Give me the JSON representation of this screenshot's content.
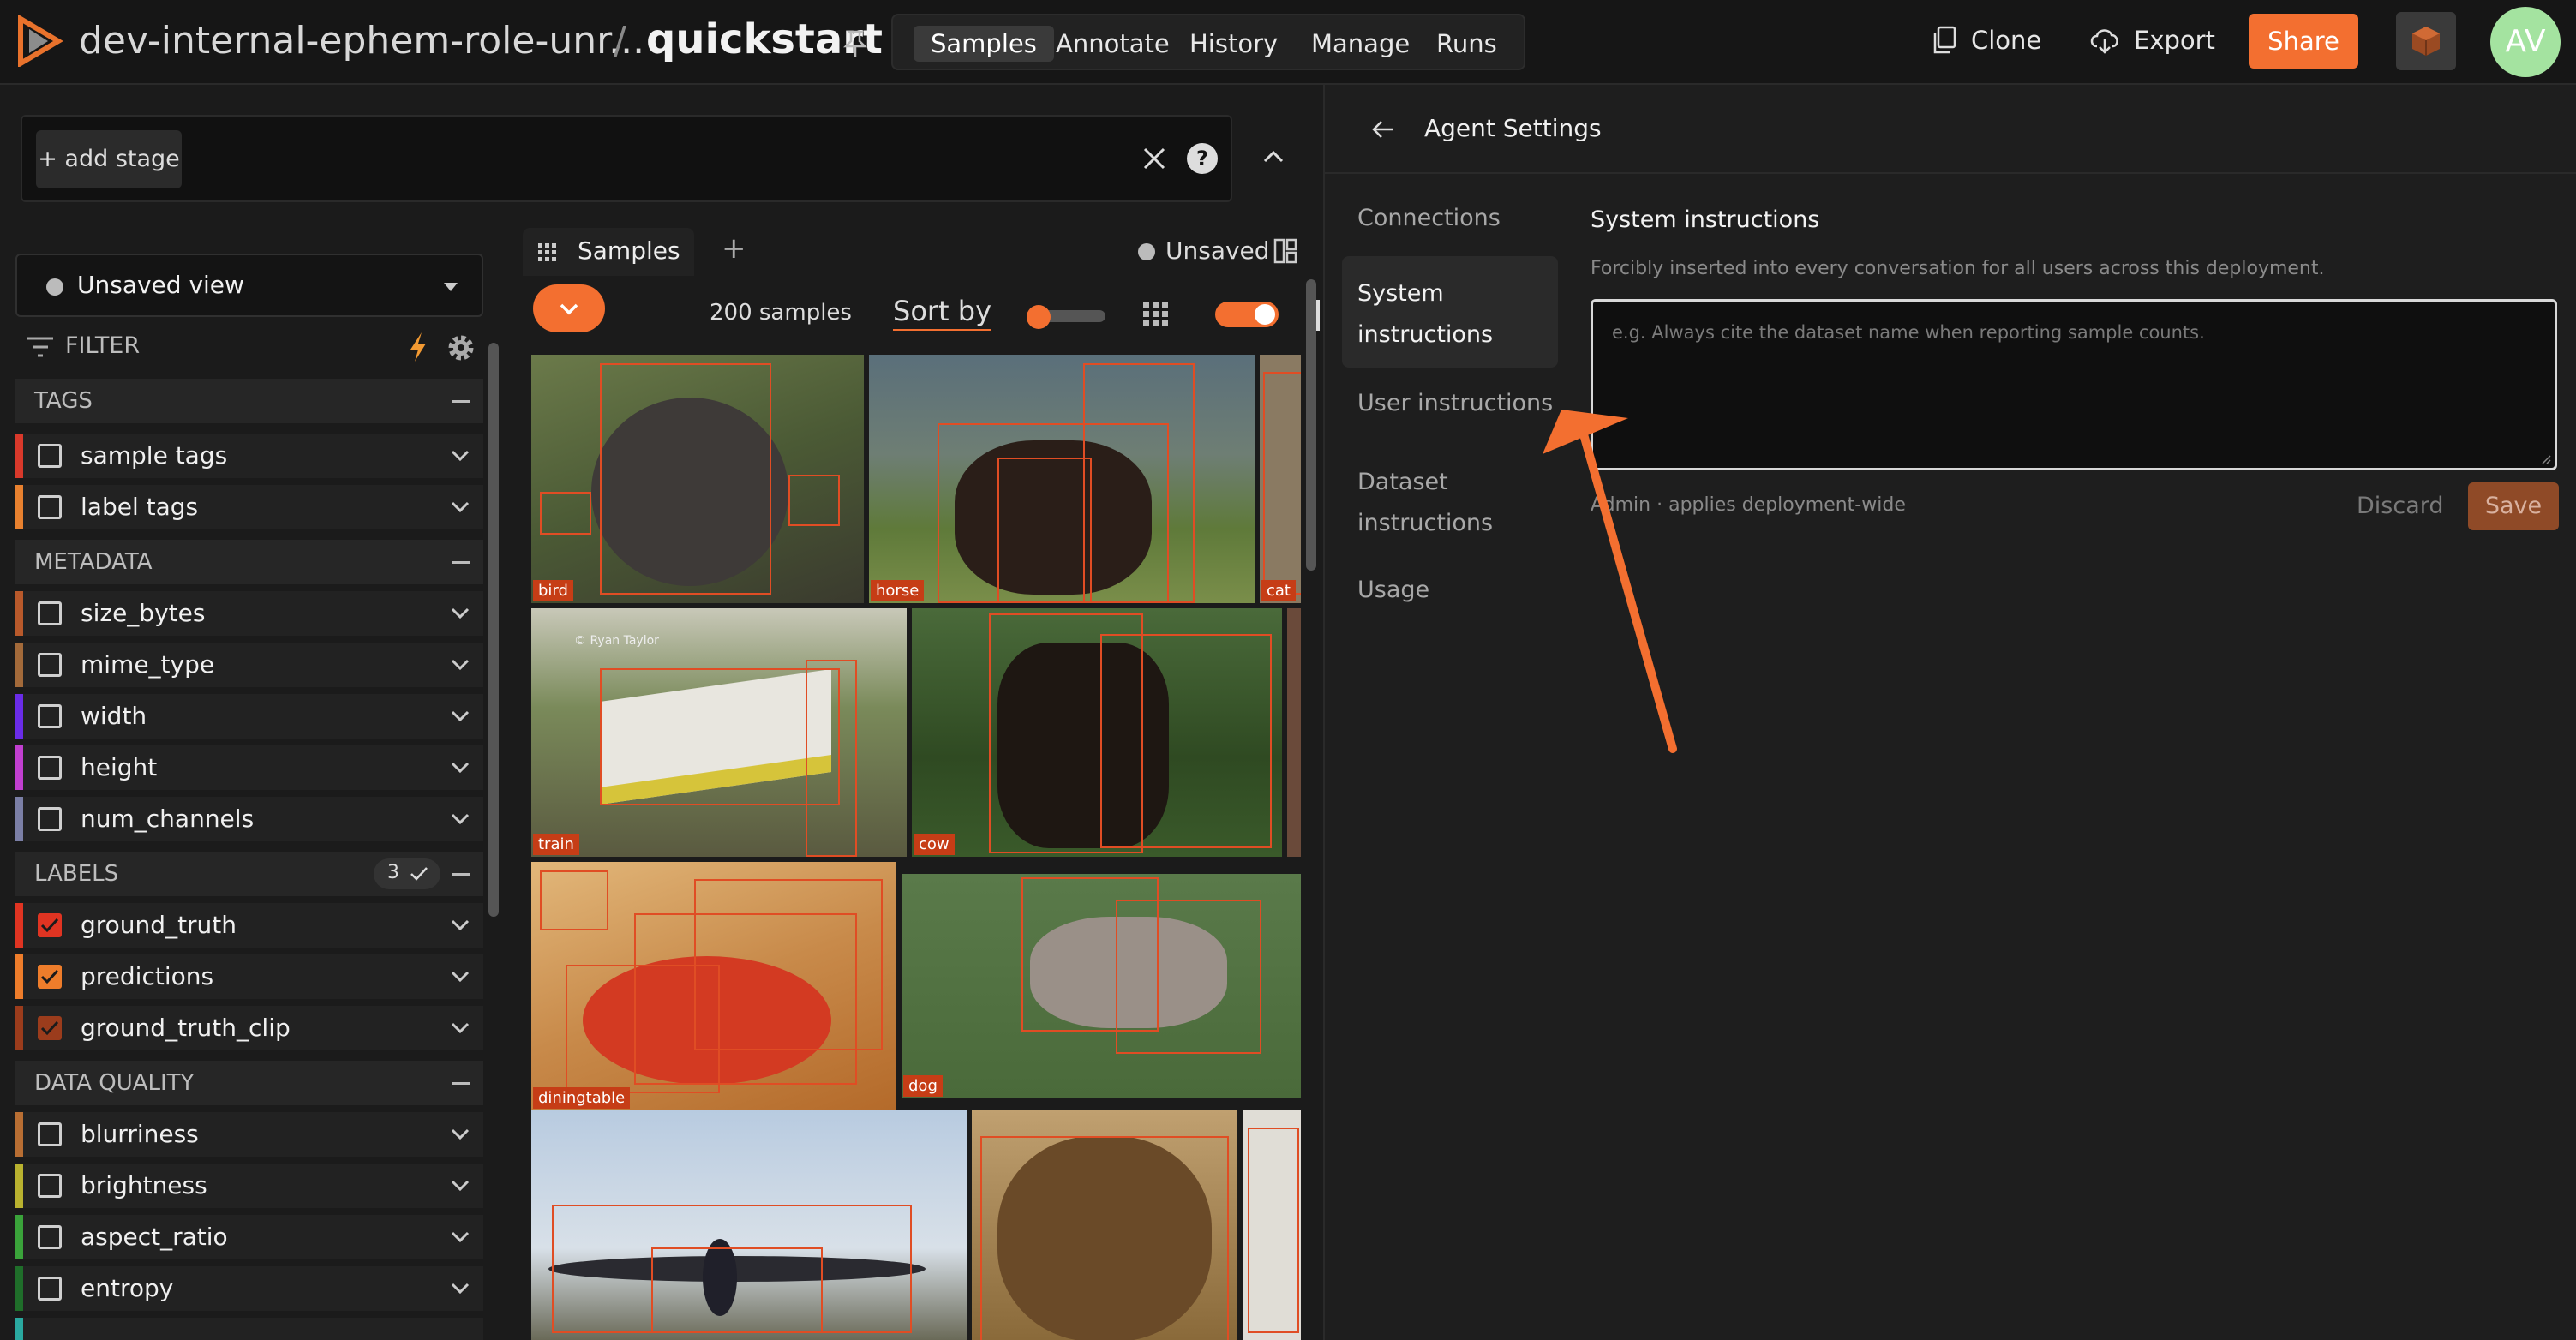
{
  "header": {
    "dataset_path": "dev-internal-ephem-role-unr...",
    "separator": "/",
    "dataset_name": "quickstart",
    "nav_tabs": [
      "Samples",
      "Annotate",
      "History",
      "Manage",
      "Runs"
    ],
    "clone_label": "Clone",
    "export_label": "Export",
    "share_label": "Share",
    "avatar_initials": "AV"
  },
  "stages": {
    "add_stage_label": "+ add stage"
  },
  "sidebar": {
    "view_label": "Unsaved view",
    "filter_label": "FILTER",
    "sections": {
      "tags": "TAGS",
      "metadata": "METADATA",
      "labels": "LABELS",
      "labels_count": "3",
      "data_quality": "DATA QUALITY"
    },
    "tag_fields": [
      "sample tags",
      "label tags"
    ],
    "metadata_fields": [
      "size_bytes",
      "mime_type",
      "width",
      "height",
      "num_channels"
    ],
    "label_fields": [
      "ground_truth",
      "predictions",
      "ground_truth_clip"
    ],
    "quality_fields": [
      "blurriness",
      "brightness",
      "aspect_ratio",
      "entropy"
    ],
    "colors": {
      "sample_tags": "#d9392b",
      "label_tags": "#e8812f",
      "size_bytes": "#b8592b",
      "mime_type": "#a36a3a",
      "width": "#6a2ce8",
      "height": "#c13fd0",
      "num_channels": "#7b7fa6",
      "ground_truth": "#e03422",
      "predictions": "#ee7d2b",
      "ground_truth_clip": "#9b3c1c",
      "blurriness": "#b86e33",
      "brightness": "#b9b22f",
      "aspect_ratio": "#3aa33a",
      "entropy": "#1f6e2a"
    }
  },
  "grid": {
    "tab_label": "Samples",
    "unsaved_label": "Unsaved",
    "sample_count": "200 samples",
    "sort_label": "Sort by",
    "class_labels": [
      "bird",
      "horse",
      "cat",
      "train",
      "cow",
      "diningtable",
      "dog"
    ],
    "watermark": "© Ryan Taylor"
  },
  "panel": {
    "title": "Agent Settings",
    "nav": [
      "Connections",
      "System instructions",
      "User instructions",
      "Dataset instructions",
      "Usage"
    ],
    "nav_active_lines": [
      "System",
      "instructions"
    ],
    "nav_dataset_lines": [
      "Dataset",
      "instructions"
    ],
    "section_title": "System instructions",
    "description": "Forcibly inserted into every conversation for all users across this deployment.",
    "placeholder": "e.g. Always cite the dataset name when reporting sample counts.",
    "footer_note": "Admin · applies deployment-wide",
    "discard_label": "Discard",
    "save_label": "Save"
  },
  "annotation": {
    "arrow_color": "#f36f30"
  }
}
